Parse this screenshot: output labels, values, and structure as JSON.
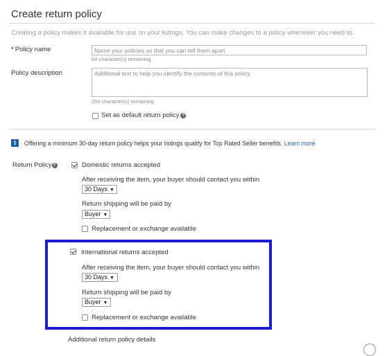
{
  "page": {
    "title": "Create return policy",
    "intro": "Creating a policy makes it available for use on your listings. You can make changes to a policy whenever you need to."
  },
  "policy_name": {
    "required_mark": "*",
    "label": "Policy name",
    "placeholder": "Name your policies so that you can tell them apart",
    "value": "",
    "remaining": "64 character(s) remaining"
  },
  "policy_description": {
    "label": "Policy description",
    "placeholder": "Additional text to help you identify the contents of this policy.",
    "value": "",
    "remaining": "250 character(s) remaining"
  },
  "default_policy": {
    "label": "Set as default return policy",
    "checked": false,
    "help_icon": "question-circle-icon",
    "help_glyph": "?"
  },
  "notice": {
    "icon": "info-icon",
    "icon_glyph": "i",
    "text": "Offering a minimum 30-day return policy helps your listings qualify for Top Rated Seller benefits.",
    "link": "Learn more"
  },
  "return_policy": {
    "label": "Return Policy",
    "help_glyph": "?",
    "domestic": {
      "label": "Domestic returns accepted",
      "checked": true,
      "contact_label": "After receiving the item, your buyer should contact you within",
      "contact_value": "30 Days",
      "shipping_label": "Return shipping will be paid by",
      "shipping_value": "Buyer",
      "replacement_label": "Replacement or exchange available",
      "replacement_checked": false
    },
    "international": {
      "label": "International returns accepted",
      "checked": true,
      "contact_label": "After receiving the item, your buyer should contact you within",
      "contact_value": "30 Days",
      "shipping_label": "Return shipping will be paid by",
      "shipping_value": "Buyer",
      "replacement_label": "Replacement or exchange available",
      "replacement_checked": false
    },
    "additional_details": "Additional return policy details"
  },
  "colors": {
    "highlight_border": "#1d1bd0",
    "link": "#1f5fa8",
    "required_star": "#2e8b2e"
  }
}
